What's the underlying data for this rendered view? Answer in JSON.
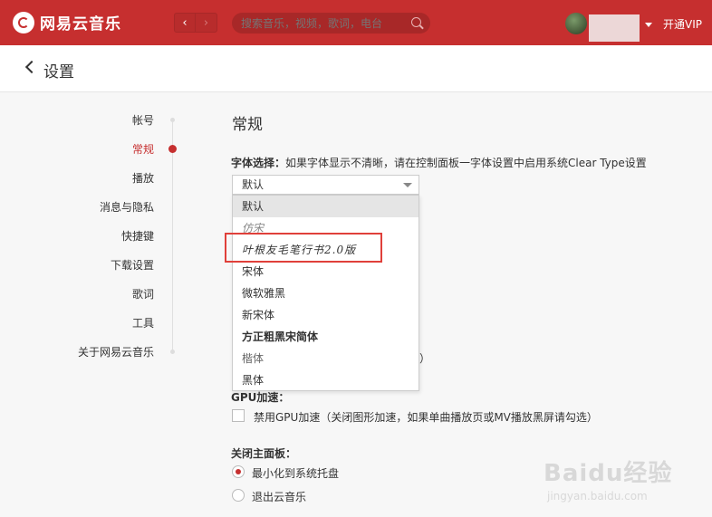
{
  "app": {
    "name": "网易云音乐",
    "vip_label": "开通VIP"
  },
  "search": {
    "placeholder": "搜索音乐，视频，歌词，电台"
  },
  "page": {
    "title": "设置"
  },
  "sidebar": {
    "items": [
      {
        "label": "帐号",
        "active": false
      },
      {
        "label": "常规",
        "active": true
      },
      {
        "label": "播放",
        "active": false
      },
      {
        "label": "消息与隐私",
        "active": false
      },
      {
        "label": "快捷键",
        "active": false
      },
      {
        "label": "下载设置",
        "active": false
      },
      {
        "label": "歌词",
        "active": false
      },
      {
        "label": "工具",
        "active": false
      },
      {
        "label": "关于网易云音乐",
        "active": false
      }
    ]
  },
  "general": {
    "title": "常规",
    "font_label": "字体选择：",
    "font_hint": "如果字体显示不清晰，请在控制面板一字体设置中启用系统Clear Type设置",
    "font_selected": "默认",
    "font_options": [
      "默认",
      "仿宋",
      "叶根友毛笔行书2.0版",
      "宋体",
      "微软雅黑",
      "新宋体",
      "方正粗黑宋简体",
      "楷体",
      "黑体"
    ],
    "highlighted_option": "叶根友毛笔行书2.0版",
    "hidden_paren": "）",
    "gpu_title": "GPU加速：",
    "gpu_checkbox_label": "禁用GPU加速（关闭图形加速，如果单曲播放页或MV播放黑屏请勾选）",
    "gpu_checked": false,
    "close_title": "关闭主面板：",
    "close_options": [
      {
        "label": "最小化到系统托盘",
        "checked": true
      },
      {
        "label": "退出云音乐",
        "checked": false
      }
    ]
  },
  "watermark": {
    "main": "Baidu经验",
    "sub": "jingyan.baidu.com"
  },
  "colors": {
    "brand": "#c62f2f",
    "highlight_box": "#e0403a"
  }
}
